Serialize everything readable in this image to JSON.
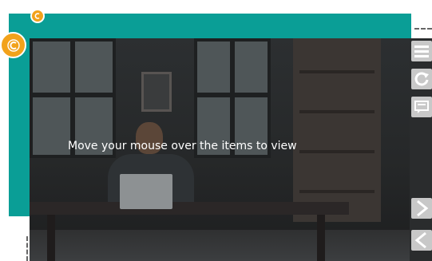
{
  "scene": {
    "instruction_text": "Move your mouse over the items to view"
  },
  "controls": {
    "menu_icon": "hamburger-menu-icon",
    "reload_icon": "reload-icon",
    "caption_icon": "caption-icon",
    "next_icon": "chevron-right-icon",
    "prev_icon": "chevron-left-icon"
  },
  "badges": {
    "small_icon": "coin-icon",
    "large_icon": "coin-icon"
  },
  "colors": {
    "frame": "#0a9e96",
    "badge": "#f2a21b",
    "control_button": "#c8c8c8"
  }
}
